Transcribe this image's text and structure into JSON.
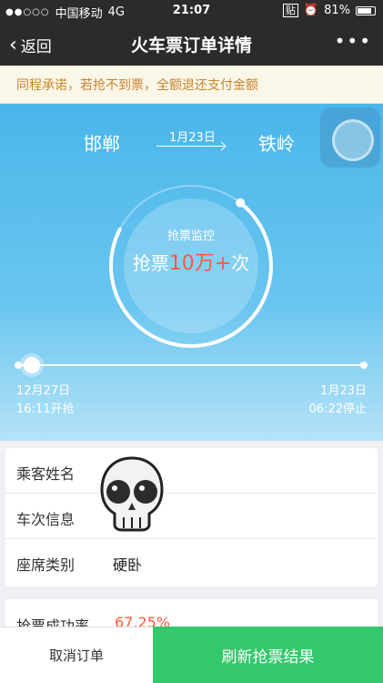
{
  "status": {
    "signal": "●●○○○",
    "carrier": "中国移动",
    "network": "4G",
    "time": "21:07",
    "paste_badge": "贴",
    "battery_text": "81%"
  },
  "nav": {
    "back_label": "返回",
    "title": "火车票订单详情",
    "more": "•••"
  },
  "notice": "同程承诺，若抢不到票，全额退还支付金额",
  "route": {
    "from": "邯郸",
    "to": "铁岭",
    "date": "1月23日"
  },
  "monitor": {
    "label": "抢票监控",
    "prefix": "抢票",
    "count": "10万+",
    "suffix": "次",
    "progress": 0.72
  },
  "timeline": {
    "start_date": "12月27日",
    "start_time": "16:11开抢",
    "end_date": "1月23日",
    "end_time": "06:22停止"
  },
  "details": {
    "passenger_label": "乘客姓名",
    "train_label": "车次信息",
    "seat_label": "座席类别",
    "seat_value": "硬卧"
  },
  "success": {
    "label": "抢票成功率",
    "value": "67.25%"
  },
  "buttons": {
    "cancel": "取消订单",
    "refresh": "刷新抢票结果"
  }
}
